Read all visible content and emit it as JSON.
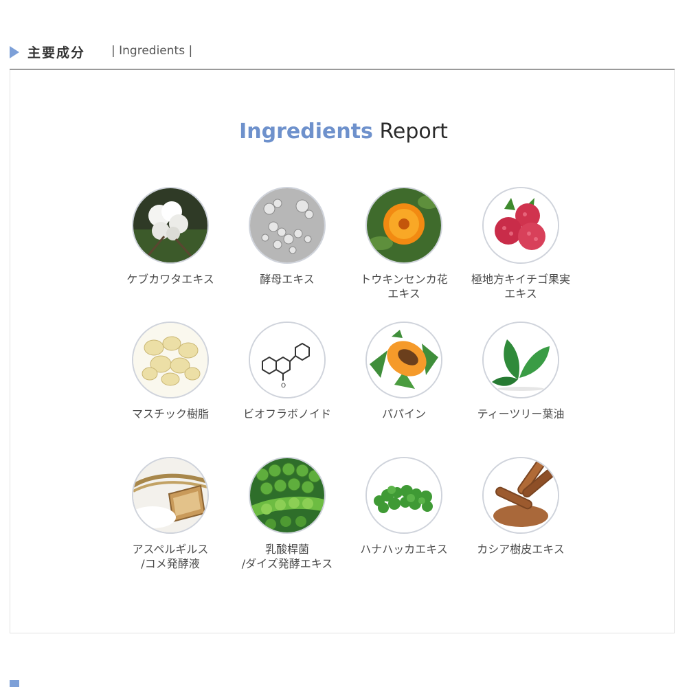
{
  "section": {
    "title_jp": "主要成分",
    "title_en": "| Ingredients |"
  },
  "report": {
    "accent": "Ingredients",
    "plain": "Report"
  },
  "ingredients": [
    {
      "label": "ケブカワタエキス",
      "icon": "cotton-icon"
    },
    {
      "label": "酵母エキス",
      "icon": "yeast-icon"
    },
    {
      "label": "トウキンセンカ花\nエキス",
      "icon": "calendula-icon"
    },
    {
      "label": "極地方キイチゴ果実\nエキス",
      "icon": "raspberry-icon"
    },
    {
      "label": "マスチック樹脂",
      "icon": "mastic-resin-icon"
    },
    {
      "label": "ビオフラボノイド",
      "icon": "flavonoid-molecule-icon"
    },
    {
      "label": "パパイン",
      "icon": "papaya-icon"
    },
    {
      "label": "ティーツリー葉油",
      "icon": "tea-tree-leaf-icon"
    },
    {
      "label": "アスペルギルス\n/コメ発酵液",
      "icon": "rice-ferment-icon"
    },
    {
      "label": "乳酸桿菌\n/ダイズ発酵エキス",
      "icon": "soybean-icon"
    },
    {
      "label": "ハナハッカエキス",
      "icon": "oregano-icon"
    },
    {
      "label": "カシア樹皮エキス",
      "icon": "cinnamon-icon"
    }
  ],
  "colors": {
    "accent": "#6e91cc",
    "arrow": "#7da0d8"
  }
}
